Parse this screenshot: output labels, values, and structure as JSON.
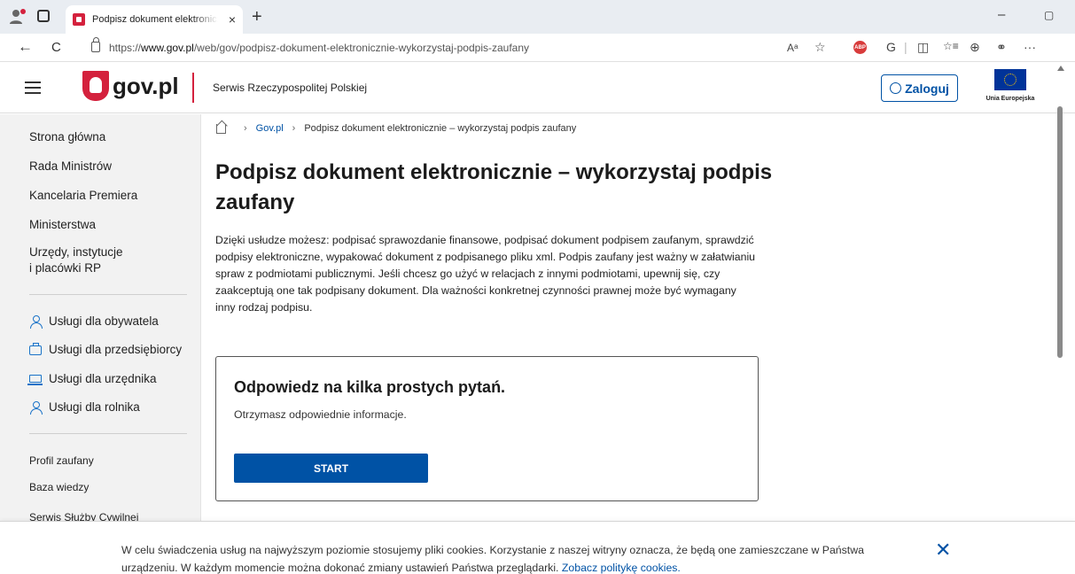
{
  "browser": {
    "tab_title": "Podpisz dokument elektronicznie",
    "tab_close": "×",
    "new_tab": "+",
    "minimize": "–",
    "restore": "▢",
    "back": "←",
    "reload": "C",
    "url_prefix": "https://",
    "url_domain": "www.gov.pl",
    "url_path": "/web/gov/podpisz-dokument-elektronicznie-wykorzystaj-podpis-zaufany",
    "ext_icons": [
      "Aᵃ",
      "☆",
      "ABP",
      "G",
      "|",
      "◫",
      "☆≡",
      "⊕",
      "⚭",
      "···"
    ]
  },
  "header": {
    "logo_text": "gov.pl",
    "serwis": "Serwis Rzeczypospolitej Polskiej",
    "login_label": "Zaloguj",
    "eu_label": "Unia Europejska"
  },
  "sidebar": {
    "main_items": [
      "Strona główna",
      "Rada Ministrów",
      "Kancelaria Premiera",
      "Ministerstwa",
      "Urzędy, instytucje",
      "i placówki RP"
    ],
    "service_items": [
      {
        "label": "Usługi dla obywatela",
        "icon": "person-icon"
      },
      {
        "label": "Usługi dla przedsiębiorcy",
        "icon": "briefcase-icon"
      },
      {
        "label": "Usługi dla urzędnika",
        "icon": "laptop-icon"
      },
      {
        "label": "Usługi dla rolnika",
        "icon": "person-icon"
      }
    ],
    "bottom_items": [
      "Profil zaufany",
      "Baza wiedzy",
      "Serwis Służby Cywilnej"
    ]
  },
  "breadcrumb": {
    "sep": "›",
    "link": "Gov.pl",
    "current": "Podpisz dokument elektronicznie – wykorzystaj podpis zaufany"
  },
  "main": {
    "title": "Podpisz dokument elektronicznie – wykorzystaj podpis zaufany",
    "intro": "Dzięki usłudze możesz: podpisać sprawozdanie finansowe, podpisać dokument podpisem zaufanym, sprawdzić podpisy elektroniczne, wypakować dokument z podpisanego pliku xml. Podpis zaufany jest ważny w załatwianiu spraw z podmiotami publicznymi. Jeśli chcesz go użyć w relacjach z innymi podmiotami, upewnij się, czy zaakceptują one tak podpisany dokument. Dla ważności konkretnej czynności prawnej może być wymagany inny rodzaj podpisu."
  },
  "quiz": {
    "heading": "Odpowiedz na kilka prostych pytań.",
    "text": "Otrzymasz odpowiednie informacje.",
    "button": "START"
  },
  "cookie": {
    "text": "W celu świadczenia usług na najwyższym poziomie stosujemy pliki cookies. Korzystanie z naszej witryny oznacza, że będą one zamieszczane w Państwa urządzeniu. W każdym momencie można dokonać zmiany ustawień Państwa przeglądarki. ",
    "link": "Zobacz politykę cookies.",
    "close": "✕"
  },
  "colors": {
    "brand_red": "#d4213d",
    "gov_blue": "#0052a5",
    "sidebar_bg": "#f2f2f2"
  }
}
